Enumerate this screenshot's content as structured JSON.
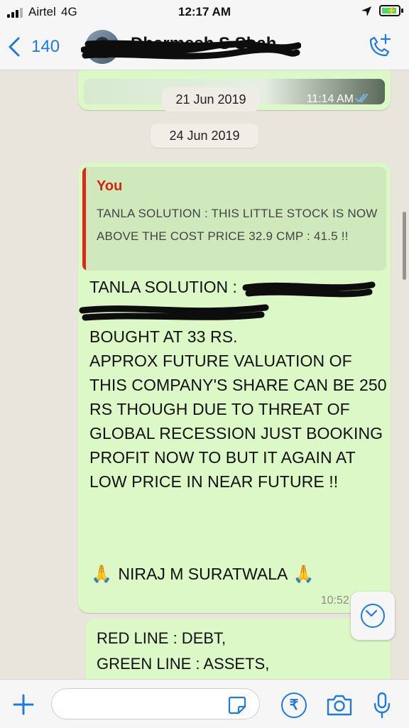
{
  "status_bar": {
    "carrier": "Airtel",
    "network": "4G",
    "time": "12:17 AM",
    "icons": [
      "signal-icon",
      "location-icon",
      "battery-charging-icon"
    ]
  },
  "header": {
    "back_label": "140",
    "contact_name": "Dharmesh S Shah",
    "icons": [
      "chevron-left-icon",
      "add-call-icon"
    ]
  },
  "chat": {
    "previous_message": {
      "image_date_text": "21 Jun 2019",
      "time": "11:14 AM"
    },
    "date_separator": "24 Jun 2019",
    "message": {
      "quoted": {
        "author": "You",
        "text": "TANLA SOLUTION : THIS LITTLE STOCK IS NOW ABOVE THE COST PRICE 32.9 CMP : 41.5 !!"
      },
      "head": "TANLA SOLUTION :",
      "body": "BOUGHT AT 33 RS.\nAPPROX FUTURE VALUATION OF THIS COMPANY'S SHARE CAN BE 250 RS THOUGH DUE TO THREAT OF GLOBAL RECESSION JUST BOOKING PROFIT NOW TO BUT IT AGAIN AT LOW PRICE IN NEAR FUTURE !!",
      "signature": "NIRAJ M SURATWALA",
      "emoji_icon": "folded-hands-icon",
      "time": "10:52 A"
    },
    "next_message": {
      "text": "RED LINE : DEBT,\nGREEN LINE : ASSETS,\nBLUE LINE : SALES"
    }
  },
  "input_bar": {
    "placeholder": "",
    "icons": [
      "plus-icon",
      "sticker-icon",
      "rupee-icon",
      "camera-icon",
      "microphone-icon"
    ]
  },
  "colors": {
    "bubble": "#dcf8c6",
    "quote_bar": "#e0271a",
    "accent": "#1f7ae0",
    "chat_background": "#e9e4dc"
  }
}
